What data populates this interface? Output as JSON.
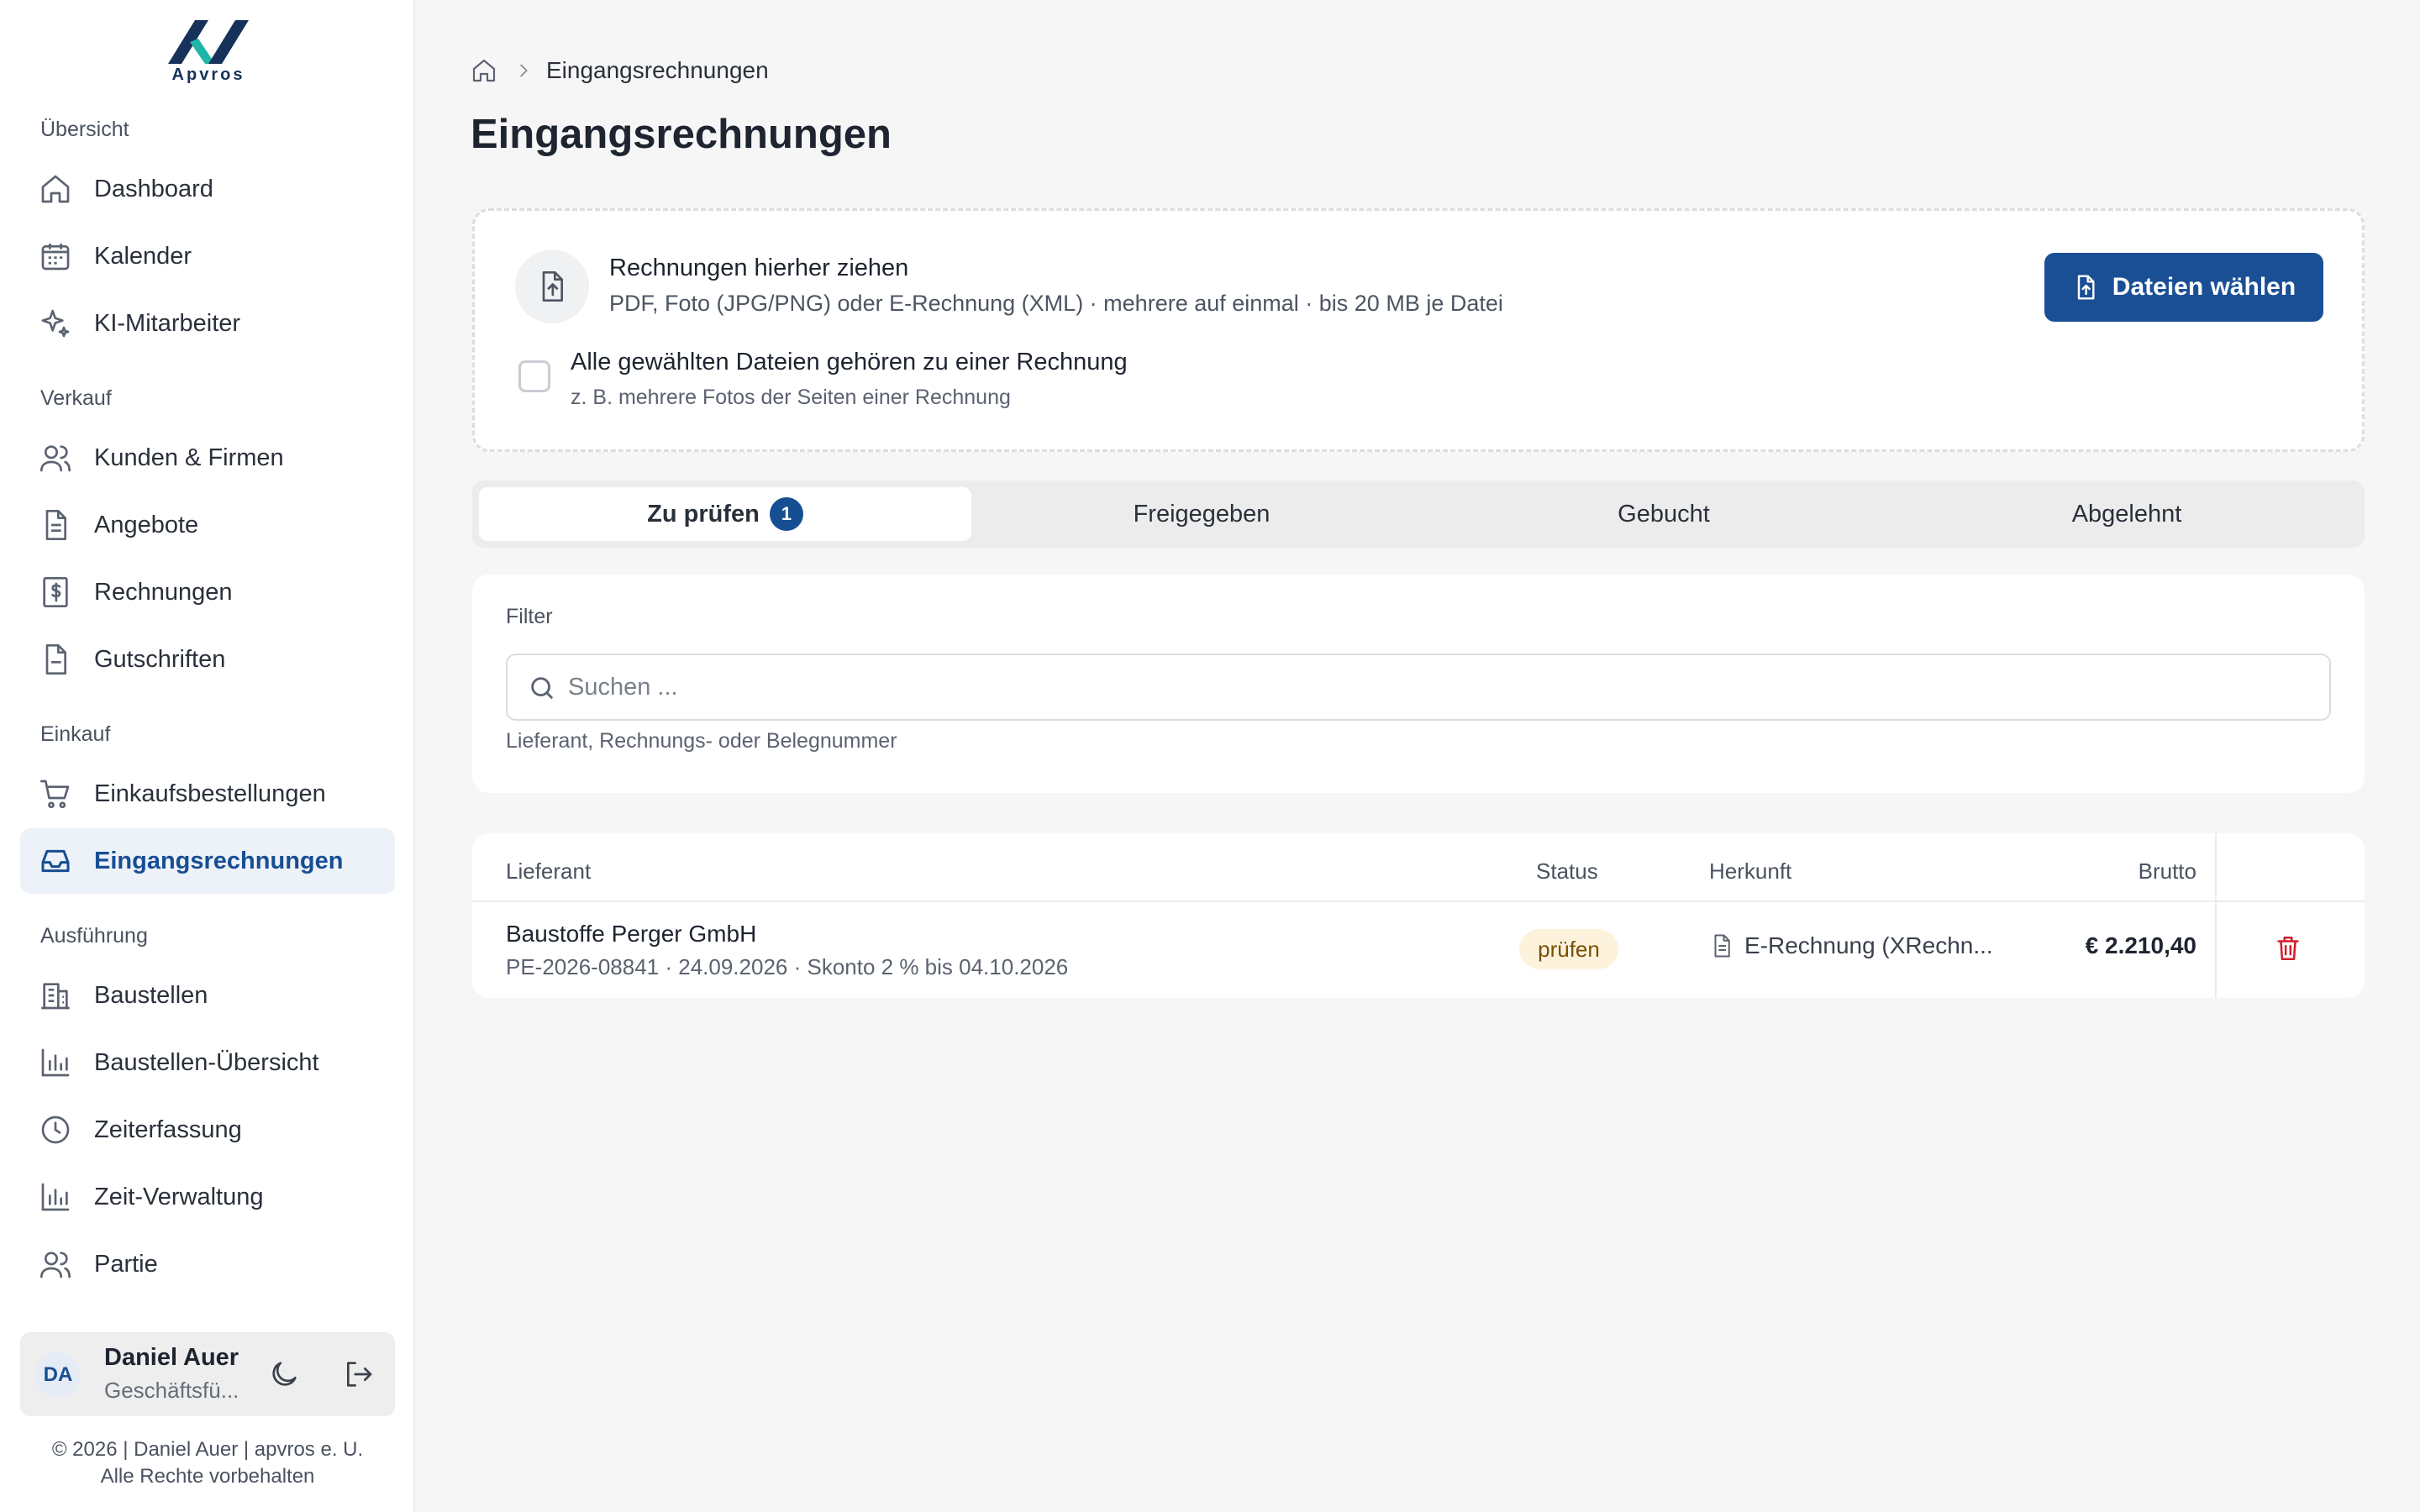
{
  "brand": {
    "logo_text": "Apvros"
  },
  "sidebar": {
    "sections": [
      {
        "label": "Übersicht"
      },
      {
        "label": "Verkauf"
      },
      {
        "label": "Einkauf"
      },
      {
        "label": "Ausführung"
      }
    ],
    "items": [
      {
        "label": "Dashboard",
        "icon": "home-icon"
      },
      {
        "label": "Kalender",
        "icon": "calendar-icon"
      },
      {
        "label": "KI-Mitarbeiter",
        "icon": "sparkles-icon"
      },
      {
        "label": "Kunden & Firmen",
        "icon": "users-icon"
      },
      {
        "label": "Angebote",
        "icon": "document-icon"
      },
      {
        "label": "Rechnungen",
        "icon": "invoice-dollar-icon"
      },
      {
        "label": "Gutschriften",
        "icon": "document-minus-icon"
      },
      {
        "label": "Einkaufsbestellungen",
        "icon": "cart-icon"
      },
      {
        "label": "Eingangsrechnungen",
        "icon": "inbox-icon",
        "active": true
      },
      {
        "label": "Baustellen",
        "icon": "building-icon"
      },
      {
        "label": "Baustellen-Übersicht",
        "icon": "bar-chart-icon"
      },
      {
        "label": "Zeiterfassung",
        "icon": "clock-icon"
      },
      {
        "label": "Zeit-Verwaltung",
        "icon": "bar-chart-icon"
      },
      {
        "label": "Partie",
        "icon": "users-icon"
      }
    ],
    "user": {
      "initials": "DA",
      "name": "Daniel Auer",
      "role": "Geschäftsfü..."
    },
    "footer": {
      "line1": "© 2026 | Daniel Auer | apvros e. U.",
      "line2": "Alle Rechte vorbehalten"
    }
  },
  "breadcrumb": {
    "current": "Eingangsrechnungen"
  },
  "page": {
    "title": "Eingangsrechnungen"
  },
  "upload": {
    "title": "Rechnungen hierher ziehen",
    "subtitle": "PDF, Foto (JPG/PNG) oder E-Rechnung (XML) · mehrere auf einmal · bis 20 MB je Datei",
    "checkbox_label": "Alle gewählten Dateien gehören zu einer Rechnung",
    "checkbox_hint": "z. B. mehrere Fotos der Seiten einer Rechnung",
    "checkbox_checked": false,
    "button_label": "Dateien wählen"
  },
  "tabs": [
    {
      "label": "Zu prüfen",
      "badge": "1",
      "active": true
    },
    {
      "label": "Freigegeben"
    },
    {
      "label": "Gebucht"
    },
    {
      "label": "Abgelehnt"
    }
  ],
  "filter": {
    "label": "Filter",
    "placeholder": "Suchen ...",
    "value": "",
    "hint": "Lieferant, Rechnungs- oder Belegnummer"
  },
  "table": {
    "columns": [
      "Lieferant",
      "Status",
      "Herkunft",
      "Brutto"
    ],
    "rows": [
      {
        "supplier": "Baustoffe Perger GmbH",
        "meta": "PE-2026-08841 · 24.09.2026 · Skonto 2 % bis 04.10.2026",
        "status": "prüfen",
        "origin": "E-Rechnung (XRechn...",
        "amount": "€ 2.210,40"
      }
    ]
  },
  "colors": {
    "accent": "#1a4f96",
    "active_nav_bg": "#edf2f9",
    "status_review_bg": "#fdf3dd",
    "status_review_fg": "#7a4e00",
    "danger": "#d01f2e"
  }
}
